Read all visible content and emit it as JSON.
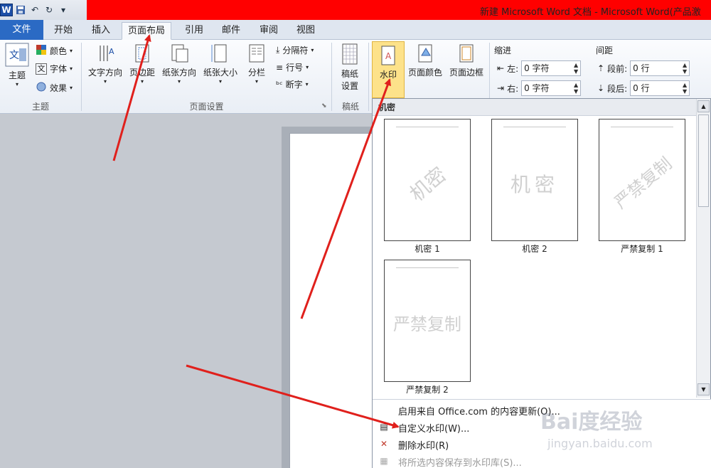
{
  "window": {
    "title": "新建 Microsoft Word 文档 - Microsoft Word(产品激",
    "app_icon": "W"
  },
  "tabs": [
    {
      "label": "文件"
    },
    {
      "label": "开始"
    },
    {
      "label": "插入"
    },
    {
      "label": "页面布局"
    },
    {
      "label": "引用"
    },
    {
      "label": "邮件"
    },
    {
      "label": "审阅"
    },
    {
      "label": "视图"
    }
  ],
  "ribbon": {
    "themes": {
      "group_label": "主题",
      "theme_label": "主题",
      "colors_label": "颜色",
      "fonts_label": "字体",
      "effects_label": "效果"
    },
    "page_setup": {
      "group_label": "页面设置",
      "text_direction": "文字方向",
      "margins": "页边距",
      "orientation": "纸张方向",
      "size": "纸张大小",
      "columns": "分栏",
      "breaks": "分隔符",
      "line_numbers": "行号",
      "hyphenation": "断字"
    },
    "manuscript": {
      "group_label": "稿纸",
      "settings_line1": "稿纸",
      "settings_line2": "设置"
    },
    "page_background": {
      "watermark": "水印",
      "page_color": "页面颜色",
      "page_borders": "页面边框"
    },
    "indent": {
      "label": "缩进",
      "left_label": "左:",
      "left_value": "0 字符",
      "right_label": "右:",
      "right_value": "0 字符"
    },
    "spacing": {
      "label": "间距",
      "before_label": "段前:",
      "before_value": "0 行",
      "after_label": "段后:",
      "after_value": "0 行"
    }
  },
  "watermark_panel": {
    "section_title": "机密",
    "items": [
      {
        "preview_text": "机密",
        "caption": "机密 1",
        "style": "diagonal"
      },
      {
        "preview_text": "机密",
        "caption": "机密 2",
        "style": "horizontal"
      },
      {
        "preview_text": "严禁复制",
        "caption": "严禁复制 1",
        "style": "diagonal"
      },
      {
        "preview_text": "严禁复制",
        "caption": "严禁复制 2",
        "style": "horizontal"
      }
    ],
    "menu": [
      {
        "label": "启用来自 Office.com 的内容更新(O)...",
        "disabled": false
      },
      {
        "label": "自定义水印(W)...",
        "disabled": false
      },
      {
        "label": "删除水印(R)",
        "disabled": false
      },
      {
        "label": "将所选内容保存到水印库(S)...",
        "disabled": true
      }
    ]
  },
  "watermark_logo": {
    "text": "Bai度经验",
    "sub": "jingyan.baidu.com"
  },
  "colors": {
    "accent": "#2b6ac4",
    "title_highlight": "#ff0000",
    "annotation_arrow": "#e0201c"
  }
}
